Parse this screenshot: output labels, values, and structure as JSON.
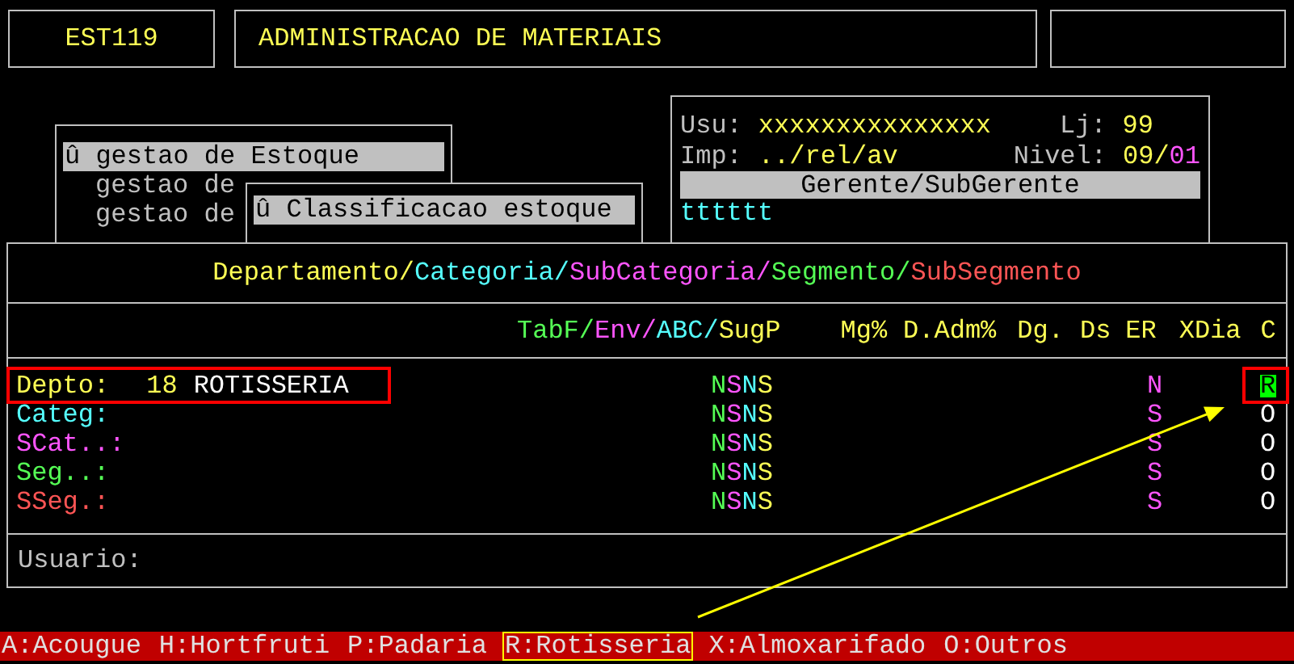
{
  "header": {
    "program_code": "EST119",
    "title": "ADMINISTRACAO DE MATERIAIS"
  },
  "menus": [
    {
      "items": [
        {
          "label": "û gestao de Estoque",
          "selected": true
        },
        {
          "label": "gestao de",
          "selected": false
        },
        {
          "label": "gestao de",
          "selected": false
        }
      ]
    },
    {
      "items": [
        {
          "label": "û Classificacao estoque",
          "selected": true
        }
      ]
    }
  ],
  "session": {
    "user_label": "Usu:",
    "user": "xxxxxxxxxxxxxxx",
    "store_label": "Lj:",
    "store": "99",
    "printer_label": "Imp:",
    "printer": "../rel/av",
    "nivel_label": "Nivel:",
    "nivel_parts": [
      {
        "text": "09/",
        "color": "#ffff55"
      },
      {
        "text": "01",
        "color": "#ff55ff"
      }
    ],
    "role": "Gerente/SubGerente",
    "terminal": "tttttt"
  },
  "panel": {
    "title_parts": [
      {
        "text": "Departamento/",
        "color": "#ffff55"
      },
      {
        "text": "Categoria/",
        "color": "#55ffff"
      },
      {
        "text": "SubCategoria/",
        "color": "#ff55ff"
      },
      {
        "text": "Segmento/",
        "color": "#55ff55"
      },
      {
        "text": "SubSegmento",
        "color": "#ff5555"
      }
    ],
    "flag_columns": [
      {
        "text": "TabF/",
        "color": "#55ff55"
      },
      {
        "text": "Env/",
        "color": "#ff55ff"
      },
      {
        "text": "ABC/",
        "color": "#55ffff"
      },
      {
        "text": "SugP",
        "color": "#ffff55"
      }
    ],
    "columns": [
      "Mg%",
      "D.Adm%",
      "Dg.",
      "Ds",
      "ER",
      "XDia",
      "C"
    ],
    "rows": [
      {
        "label": "Depto:",
        "color": "#ffff55",
        "code": "18",
        "name": "ROTISSERIA",
        "flags": "NSNS",
        "er": "N",
        "c": "R",
        "focused": true
      },
      {
        "label": "Categ:",
        "color": "#55ffff",
        "flags": "NSNS",
        "er": "S",
        "c": "O",
        "focused": false
      },
      {
        "label": "SCat..:",
        "color": "#ff55ff",
        "flags": "NSNS",
        "er": "S",
        "c": "O",
        "focused": false
      },
      {
        "label": "Seg..:",
        "color": "#55ff55",
        "flags": "NSNS",
        "er": "S",
        "c": "O",
        "focused": false
      },
      {
        "label": "SSeg.:",
        "color": "#ff5555",
        "flags": "NSNS",
        "er": "S",
        "c": "O",
        "focused": false
      }
    ],
    "user_label": "Usuario:"
  },
  "shortcuts": [
    {
      "label": "A:Acougue",
      "selected": false
    },
    {
      "label": "H:Hortfruti",
      "selected": false
    },
    {
      "label": "P:Padaria",
      "selected": false
    },
    {
      "label": "R:Rotisseria",
      "selected": true
    },
    {
      "label": "X:Almoxarifado",
      "selected": false
    },
    {
      "label": "O:Outros",
      "selected": false
    }
  ]
}
